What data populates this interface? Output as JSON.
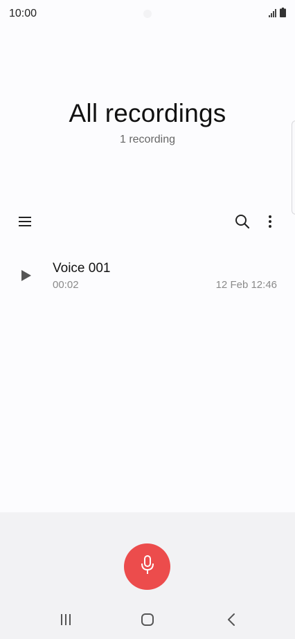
{
  "status_bar": {
    "time": "10:00",
    "icons": [
      "signal-icon",
      "battery-icon"
    ]
  },
  "header": {
    "title": "All recordings",
    "subtitle": "1 recording"
  },
  "toolbar": {
    "icons": [
      "menu-icon",
      "search-icon",
      "more-vert-icon"
    ]
  },
  "recordings": [
    {
      "name": "Voice 001",
      "duration": "00:02",
      "date": "12 Feb 12:46",
      "icon": "play-icon"
    }
  ],
  "record_button": {
    "icon": "microphone-icon",
    "color": "#ec4c4c"
  },
  "nav_bar": {
    "icons": [
      "recents-icon",
      "home-icon",
      "back-icon"
    ]
  }
}
